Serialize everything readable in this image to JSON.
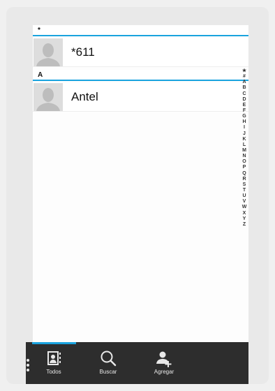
{
  "contacts_list": {
    "sections": [
      {
        "header": "*",
        "contacts": [
          {
            "name": "*611"
          }
        ]
      },
      {
        "header": "A",
        "contacts": [
          {
            "name": "Antel"
          }
        ]
      }
    ]
  },
  "alpha_index": [
    "★",
    "#",
    "A",
    "B",
    "C",
    "D",
    "E",
    "F",
    "G",
    "H",
    "I",
    "J",
    "K",
    "L",
    "M",
    "N",
    "O",
    "P",
    "Q",
    "R",
    "S",
    "T",
    "U",
    "V",
    "W",
    "X",
    "Y",
    "Z"
  ],
  "toolbar": {
    "tabs": [
      {
        "label": "Todos",
        "icon": "contacts-book-icon",
        "active": true
      },
      {
        "label": "Buscar",
        "icon": "search-icon",
        "active": false
      },
      {
        "label": "Agregar",
        "icon": "add-contact-icon",
        "active": false
      }
    ],
    "menu_icon": "overflow-menu-icon"
  },
  "colors": {
    "accent": "#1aa3de",
    "toolbar_bg": "#2d2d2d",
    "avatar_bg": "#dddddd"
  }
}
